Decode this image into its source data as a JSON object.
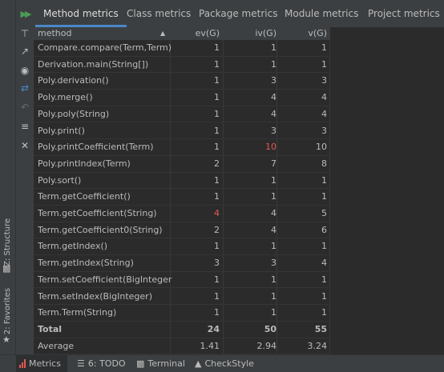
{
  "tabs": [
    "Method metrics",
    "Class metrics",
    "Package metrics",
    "Module metrics",
    "Project metrics"
  ],
  "active_tab": 0,
  "columns": [
    "method",
    "ev(G)",
    "iv(G)",
    "v(G)"
  ],
  "rows": [
    {
      "method": "Compare.compare(Term,Term)",
      "ev": "1",
      "iv": "1",
      "v": "1"
    },
    {
      "method": "Derivation.main(String[])",
      "ev": "1",
      "iv": "1",
      "v": "1"
    },
    {
      "method": "Poly.derivation()",
      "ev": "1",
      "iv": "3",
      "v": "3"
    },
    {
      "method": "Poly.merge()",
      "ev": "1",
      "iv": "4",
      "v": "4"
    },
    {
      "method": "Poly.poly(String)",
      "ev": "1",
      "iv": "4",
      "v": "4"
    },
    {
      "method": "Poly.print()",
      "ev": "1",
      "iv": "3",
      "v": "3"
    },
    {
      "method": "Poly.printCoefficient(Term)",
      "ev": "1",
      "iv": "10",
      "v": "10"
    },
    {
      "method": "Poly.printIndex(Term)",
      "ev": "2",
      "iv": "7",
      "v": "8"
    },
    {
      "method": "Poly.sort()",
      "ev": "1",
      "iv": "1",
      "v": "1"
    },
    {
      "method": "Term.getCoefficient()",
      "ev": "1",
      "iv": "1",
      "v": "1"
    },
    {
      "method": "Term.getCoefficient(String)",
      "ev": "4",
      "iv": "4",
      "v": "5"
    },
    {
      "method": "Term.getCoefficient0(String)",
      "ev": "2",
      "iv": "4",
      "v": "6"
    },
    {
      "method": "Term.getIndex()",
      "ev": "1",
      "iv": "1",
      "v": "1"
    },
    {
      "method": "Term.getIndex(String)",
      "ev": "3",
      "iv": "3",
      "v": "4"
    },
    {
      "method": "Term.setCoefficient(BigInteger)",
      "ev": "1",
      "iv": "1",
      "v": "1"
    },
    {
      "method": "Term.setIndex(BigInteger)",
      "ev": "1",
      "iv": "1",
      "v": "1"
    },
    {
      "method": "Term.Term(String)",
      "ev": "1",
      "iv": "1",
      "v": "1"
    }
  ],
  "highlight": {
    "iv_row": 6,
    "ev_row": 10,
    "color": "#e5574f"
  },
  "total": {
    "label": "Total",
    "ev": "24",
    "iv": "50",
    "v": "55"
  },
  "average": {
    "label": "Average",
    "ev": "1.41",
    "iv": "2.94",
    "v": "3.24"
  },
  "sidebar": {
    "structure": "Z: Structure",
    "favorites": "2: Favorites"
  },
  "bottom_tabs": {
    "metrics": "Metrics",
    "todo": "6: TODO",
    "terminal": "Terminal",
    "checkstyle": "CheckStyle"
  },
  "colors": {
    "background": "#2b2b2b",
    "panel": "#3c3f41",
    "accent": "#4a88c7",
    "run": "#499c54"
  }
}
